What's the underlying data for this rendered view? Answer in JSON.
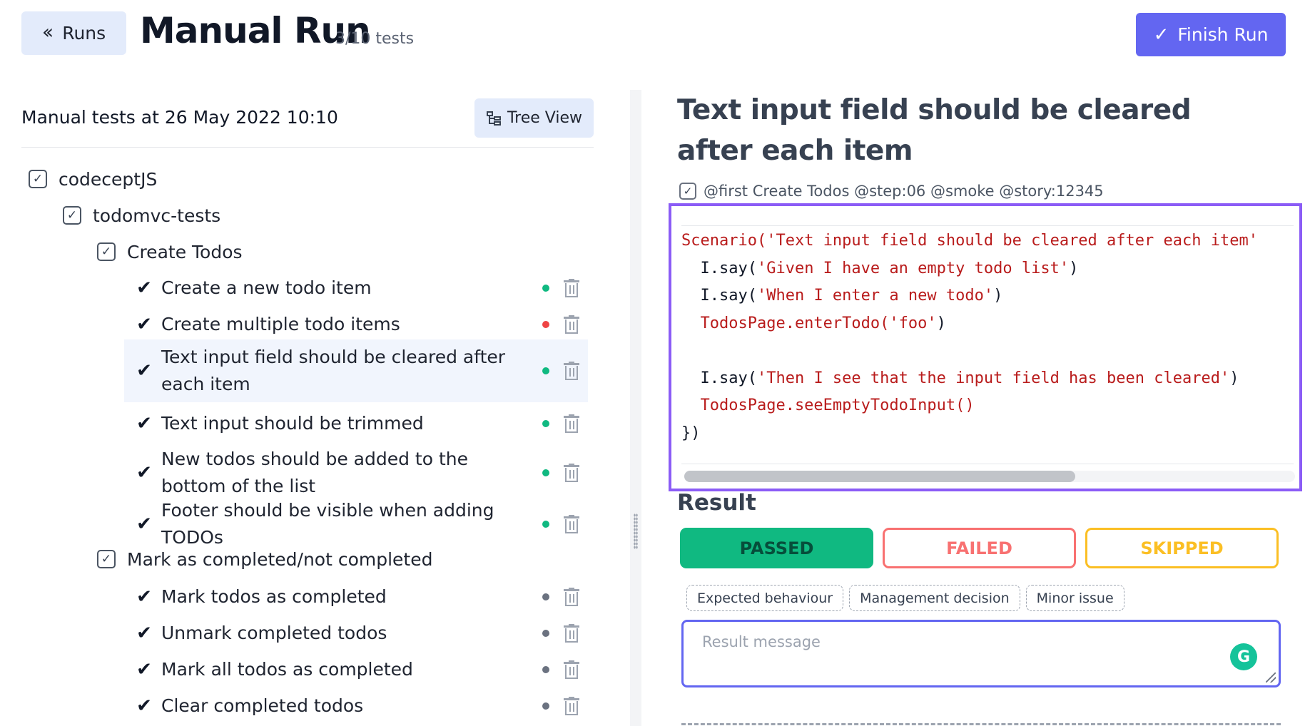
{
  "header": {
    "runs_label": "Runs",
    "title": "Manual Run",
    "test_count": "3/10 tests",
    "finish_label": "Finish Run"
  },
  "left": {
    "suite_title": "Manual tests at 26 May 2022 10:10",
    "tree_view_label": "Tree View",
    "folders": {
      "root": "codeceptJS",
      "sub": "todomvc-tests",
      "create": "Create Todos",
      "mark": "Mark as completed/not completed"
    },
    "tests": [
      {
        "label": "Create a new todo item",
        "status": "green"
      },
      {
        "label": "Create multiple todo items",
        "status": "red"
      },
      {
        "label": "Text input field should be cleared after each item",
        "status": "green",
        "selected": true
      },
      {
        "label": "Text input should be trimmed",
        "status": "green"
      },
      {
        "label": "New todos should be added to the bottom of the list",
        "status": "green"
      },
      {
        "label": "Footer should be visible when adding TODOs",
        "status": "green"
      },
      {
        "label": "Mark todos as completed",
        "status": "gray"
      },
      {
        "label": "Unmark completed todos",
        "status": "gray"
      },
      {
        "label": "Mark all todos as completed",
        "status": "gray"
      },
      {
        "label": "Clear completed todos",
        "status": "gray"
      }
    ]
  },
  "right": {
    "test_title": "Text input field should be cleared after each item",
    "tags": "@first Create Todos @step:06 @smoke @story:12345",
    "code": {
      "l1_fn": "Scenario(",
      "l1_str": "'Text input field should be cleared after each item'",
      "l2_a": "  I.say(",
      "l2_str": "'Given I have an empty todo list'",
      "l2_b": ")",
      "l3_a": "  I.say(",
      "l3_str": "'When I enter a new todo'",
      "l3_b": ")",
      "l4_fn": "  TodosPage.enterTodo(",
      "l4_str": "'foo'",
      "l4_b": ")",
      "l6_a": "  I.say(",
      "l6_str": "'Then I see that the input field has been cleared'",
      "l6_b": ")",
      "l7_fn": "  TodosPage.seeEmptyTodoInput()",
      "l8": "})"
    },
    "result_heading": "Result",
    "status_buttons": {
      "passed": "PASSED",
      "failed": "FAILED",
      "skipped": "SKIPPED"
    },
    "chips": [
      "Expected behaviour",
      "Management decision",
      "Minor issue"
    ],
    "message_placeholder": "Result message",
    "grammarly_letter": "G"
  },
  "colors": {
    "accent": "#6366f1",
    "highlight_border": "#8b5cf6",
    "passed": "#10b981",
    "failed": "#f87171",
    "skipped": "#fbbf24"
  }
}
